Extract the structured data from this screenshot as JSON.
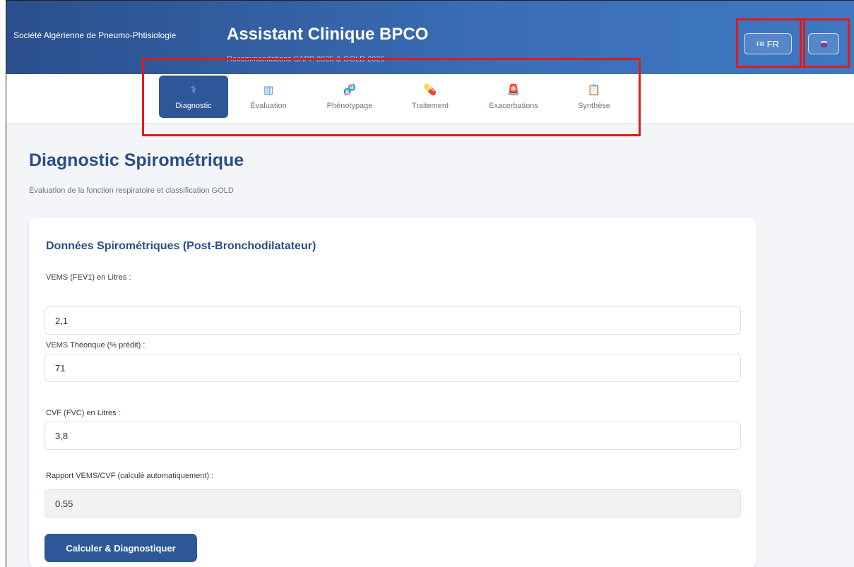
{
  "header": {
    "org": "Société Algérienne de Pneumo-Phtisiologie",
    "title": "Assistant Clinique BPCO",
    "subtitle": "Recommandations SAPP 2025 & GOLD 2026",
    "lang_code_small": "FR",
    "lang_label": "FR",
    "print_icon": "printer-icon"
  },
  "nav": {
    "tabs": [
      {
        "label": "Diagnostic",
        "icon": "stethoscope-icon",
        "glyph": "⚕",
        "active": true
      },
      {
        "label": "Évaluation",
        "icon": "bar-chart-icon",
        "glyph": "▥",
        "active": false
      },
      {
        "label": "Phénotypage",
        "icon": "dna-icon",
        "glyph": "🧬",
        "active": false
      },
      {
        "label": "Traitement",
        "icon": "pill-icon",
        "glyph": "💊",
        "active": false
      },
      {
        "label": "Exacerbations",
        "icon": "alarm-light-icon",
        "glyph": "🚨",
        "active": false
      },
      {
        "label": "Synthèse",
        "icon": "clipboard-icon",
        "glyph": "📋",
        "active": false
      }
    ]
  },
  "main": {
    "title": "Diagnostic Spirométrique",
    "subtitle": "Évaluation de la fonction respiratoire et classification GOLD",
    "card": {
      "title": "Données Spirométriques (Post-Bronchodilatateur)",
      "fields": [
        {
          "label": "VEMS (FEV1) en Litres :",
          "value": "2,1"
        },
        {
          "label": "VEMS Théorique (% prédit) :",
          "value": "71"
        },
        {
          "label": "CVF (FVC) en Litres :",
          "value": "3,8"
        },
        {
          "label": "Rapport VEMS/CVF (calculé automatiquement) :",
          "value": "0.55"
        }
      ],
      "button": "Calculer & Diagnostiquer"
    }
  },
  "colors": {
    "header": "#3a6fb8",
    "accent": "#2d5797",
    "title": "#2a4d8a",
    "highlight": "#e11a1a"
  }
}
